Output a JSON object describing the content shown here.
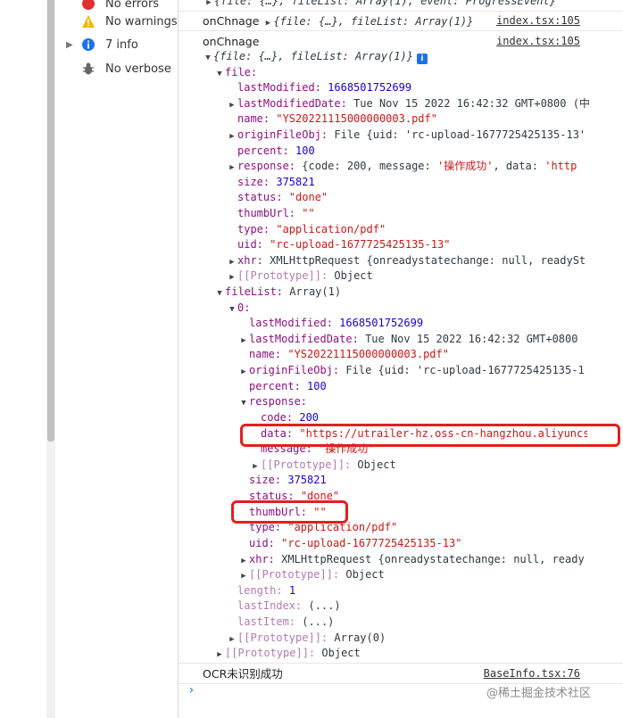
{
  "sidebar": {
    "items": [
      {
        "arrow": "",
        "label": "No errors"
      },
      {
        "arrow": "",
        "label": "No warnings"
      },
      {
        "arrow": "▶",
        "label": "7 info"
      },
      {
        "arrow": "",
        "label": "No verbose"
      }
    ]
  },
  "console": {
    "top_line": "{file: {…}, fileList: Array(1), event: ProgressEvent}",
    "msg1": {
      "text": "onChnage",
      "preview": "{file: {…}, fileList: Array(1)}",
      "source": "index.tsx:105"
    },
    "msg2": {
      "text": "onChnage",
      "preview": "{file: {…}, fileList: Array(1)}",
      "source": "index.tsx:105"
    },
    "file": {
      "label": "file:",
      "lastModified": "1668501752699",
      "lastModifiedDate": "Tue Nov 15 2022 16:42:32 GMT+0800 (中",
      "name": "\"YS20221115000000003.pdf\"",
      "originFileObj": "File {uid: 'rc-upload-1677725425135-13'",
      "percent": "100",
      "response_pre": "{code: 200, message: ",
      "response_msg": "'操作成功'",
      "response_post": ", data: ",
      "response_data": "'http",
      "size": "375821",
      "status": "\"done\"",
      "thumbUrl": "\"\"",
      "type": "\"application/pdf\"",
      "uid": "\"rc-upload-1677725425135-13\"",
      "xhr": "XMLHttpRequest {onreadystatechange: null, readySt",
      "prototype": "Object"
    },
    "fileList": {
      "label": "fileList:",
      "value": "Array(1)",
      "item_label": "0:",
      "lastModified": "1668501752699",
      "lastModifiedDate": "Tue Nov 15 2022 16:42:32 GMT+0800",
      "name": "\"YS20221115000000003.pdf\"",
      "originFileObj": "File {uid: 'rc-upload-1677725425135-1",
      "percent": "100",
      "response_label": "response:",
      "code": "200",
      "data": "\"https://utrailer-hz.oss-cn-hangzhou.aliyuncs",
      "message": "\"操作成功\"",
      "response_prototype": "Object",
      "size": "375821",
      "status": "\"done\"",
      "thumbUrl": "\"\"",
      "type": "\"application/pdf\"",
      "uid": "\"rc-upload-1677725425135-13\"",
      "xhr": "XMLHttpRequest {onreadystatechange: null, ready",
      "prototype": "Object",
      "length": "1",
      "lastIndex": "(...)",
      "lastItem": "(...)",
      "array_prototype": "Array(0)",
      "object_prototype": "Object"
    },
    "msg3": {
      "text": "OCR未识别成功",
      "source": "BaseInfo.tsx:76"
    }
  },
  "keys": {
    "lastModified": "lastModified:",
    "lastModifiedDate": "lastModifiedDate:",
    "name": "name:",
    "originFileObj": "originFileObj:",
    "percent": "percent:",
    "response": "response:",
    "size": "size:",
    "status": "status:",
    "thumbUrl": "thumbUrl:",
    "type": "type:",
    "uid": "uid:",
    "xhr": "xhr:",
    "prototype": "[[Prototype]]:",
    "code": "code:",
    "data": "data:",
    "message": "message:",
    "length": "length:",
    "lastIndex": "lastIndex:",
    "lastItem": "lastItem:"
  },
  "watermark": "@稀土掘金技术社区",
  "colors": {
    "highlight": "#e02020",
    "info_blue": "#1a73e8",
    "key": "#881280",
    "string": "#c41a16",
    "number": "#1c00cf"
  }
}
